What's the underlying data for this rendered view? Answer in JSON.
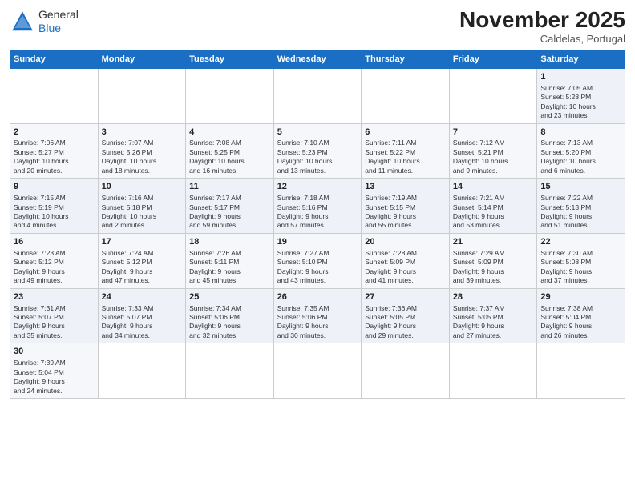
{
  "header": {
    "logo_general": "General",
    "logo_blue": "Blue",
    "month_title": "November 2025",
    "subtitle": "Caldelas, Portugal"
  },
  "days_of_week": [
    "Sunday",
    "Monday",
    "Tuesday",
    "Wednesday",
    "Thursday",
    "Friday",
    "Saturday"
  ],
  "weeks": [
    [
      {
        "day": "",
        "lines": []
      },
      {
        "day": "",
        "lines": []
      },
      {
        "day": "",
        "lines": []
      },
      {
        "day": "",
        "lines": []
      },
      {
        "day": "",
        "lines": []
      },
      {
        "day": "",
        "lines": []
      },
      {
        "day": "1",
        "lines": [
          "Sunrise: 7:05 AM",
          "Sunset: 5:28 PM",
          "Daylight: 10 hours",
          "and 23 minutes."
        ]
      }
    ],
    [
      {
        "day": "2",
        "lines": [
          "Sunrise: 7:06 AM",
          "Sunset: 5:27 PM",
          "Daylight: 10 hours",
          "and 20 minutes."
        ]
      },
      {
        "day": "3",
        "lines": [
          "Sunrise: 7:07 AM",
          "Sunset: 5:26 PM",
          "Daylight: 10 hours",
          "and 18 minutes."
        ]
      },
      {
        "day": "4",
        "lines": [
          "Sunrise: 7:08 AM",
          "Sunset: 5:25 PM",
          "Daylight: 10 hours",
          "and 16 minutes."
        ]
      },
      {
        "day": "5",
        "lines": [
          "Sunrise: 7:10 AM",
          "Sunset: 5:23 PM",
          "Daylight: 10 hours",
          "and 13 minutes."
        ]
      },
      {
        "day": "6",
        "lines": [
          "Sunrise: 7:11 AM",
          "Sunset: 5:22 PM",
          "Daylight: 10 hours",
          "and 11 minutes."
        ]
      },
      {
        "day": "7",
        "lines": [
          "Sunrise: 7:12 AM",
          "Sunset: 5:21 PM",
          "Daylight: 10 hours",
          "and 9 minutes."
        ]
      },
      {
        "day": "8",
        "lines": [
          "Sunrise: 7:13 AM",
          "Sunset: 5:20 PM",
          "Daylight: 10 hours",
          "and 6 minutes."
        ]
      }
    ],
    [
      {
        "day": "9",
        "lines": [
          "Sunrise: 7:15 AM",
          "Sunset: 5:19 PM",
          "Daylight: 10 hours",
          "and 4 minutes."
        ]
      },
      {
        "day": "10",
        "lines": [
          "Sunrise: 7:16 AM",
          "Sunset: 5:18 PM",
          "Daylight: 10 hours",
          "and 2 minutes."
        ]
      },
      {
        "day": "11",
        "lines": [
          "Sunrise: 7:17 AM",
          "Sunset: 5:17 PM",
          "Daylight: 9 hours",
          "and 59 minutes."
        ]
      },
      {
        "day": "12",
        "lines": [
          "Sunrise: 7:18 AM",
          "Sunset: 5:16 PM",
          "Daylight: 9 hours",
          "and 57 minutes."
        ]
      },
      {
        "day": "13",
        "lines": [
          "Sunrise: 7:19 AM",
          "Sunset: 5:15 PM",
          "Daylight: 9 hours",
          "and 55 minutes."
        ]
      },
      {
        "day": "14",
        "lines": [
          "Sunrise: 7:21 AM",
          "Sunset: 5:14 PM",
          "Daylight: 9 hours",
          "and 53 minutes."
        ]
      },
      {
        "day": "15",
        "lines": [
          "Sunrise: 7:22 AM",
          "Sunset: 5:13 PM",
          "Daylight: 9 hours",
          "and 51 minutes."
        ]
      }
    ],
    [
      {
        "day": "16",
        "lines": [
          "Sunrise: 7:23 AM",
          "Sunset: 5:12 PM",
          "Daylight: 9 hours",
          "and 49 minutes."
        ]
      },
      {
        "day": "17",
        "lines": [
          "Sunrise: 7:24 AM",
          "Sunset: 5:12 PM",
          "Daylight: 9 hours",
          "and 47 minutes."
        ]
      },
      {
        "day": "18",
        "lines": [
          "Sunrise: 7:26 AM",
          "Sunset: 5:11 PM",
          "Daylight: 9 hours",
          "and 45 minutes."
        ]
      },
      {
        "day": "19",
        "lines": [
          "Sunrise: 7:27 AM",
          "Sunset: 5:10 PM",
          "Daylight: 9 hours",
          "and 43 minutes."
        ]
      },
      {
        "day": "20",
        "lines": [
          "Sunrise: 7:28 AM",
          "Sunset: 5:09 PM",
          "Daylight: 9 hours",
          "and 41 minutes."
        ]
      },
      {
        "day": "21",
        "lines": [
          "Sunrise: 7:29 AM",
          "Sunset: 5:09 PM",
          "Daylight: 9 hours",
          "and 39 minutes."
        ]
      },
      {
        "day": "22",
        "lines": [
          "Sunrise: 7:30 AM",
          "Sunset: 5:08 PM",
          "Daylight: 9 hours",
          "and 37 minutes."
        ]
      }
    ],
    [
      {
        "day": "23",
        "lines": [
          "Sunrise: 7:31 AM",
          "Sunset: 5:07 PM",
          "Daylight: 9 hours",
          "and 35 minutes."
        ]
      },
      {
        "day": "24",
        "lines": [
          "Sunrise: 7:33 AM",
          "Sunset: 5:07 PM",
          "Daylight: 9 hours",
          "and 34 minutes."
        ]
      },
      {
        "day": "25",
        "lines": [
          "Sunrise: 7:34 AM",
          "Sunset: 5:06 PM",
          "Daylight: 9 hours",
          "and 32 minutes."
        ]
      },
      {
        "day": "26",
        "lines": [
          "Sunrise: 7:35 AM",
          "Sunset: 5:06 PM",
          "Daylight: 9 hours",
          "and 30 minutes."
        ]
      },
      {
        "day": "27",
        "lines": [
          "Sunrise: 7:36 AM",
          "Sunset: 5:05 PM",
          "Daylight: 9 hours",
          "and 29 minutes."
        ]
      },
      {
        "day": "28",
        "lines": [
          "Sunrise: 7:37 AM",
          "Sunset: 5:05 PM",
          "Daylight: 9 hours",
          "and 27 minutes."
        ]
      },
      {
        "day": "29",
        "lines": [
          "Sunrise: 7:38 AM",
          "Sunset: 5:04 PM",
          "Daylight: 9 hours",
          "and 26 minutes."
        ]
      }
    ],
    [
      {
        "day": "30",
        "lines": [
          "Sunrise: 7:39 AM",
          "Sunset: 5:04 PM",
          "Daylight: 9 hours",
          "and 24 minutes."
        ]
      },
      {
        "day": "",
        "lines": []
      },
      {
        "day": "",
        "lines": []
      },
      {
        "day": "",
        "lines": []
      },
      {
        "day": "",
        "lines": []
      },
      {
        "day": "",
        "lines": []
      },
      {
        "day": "",
        "lines": []
      }
    ]
  ]
}
